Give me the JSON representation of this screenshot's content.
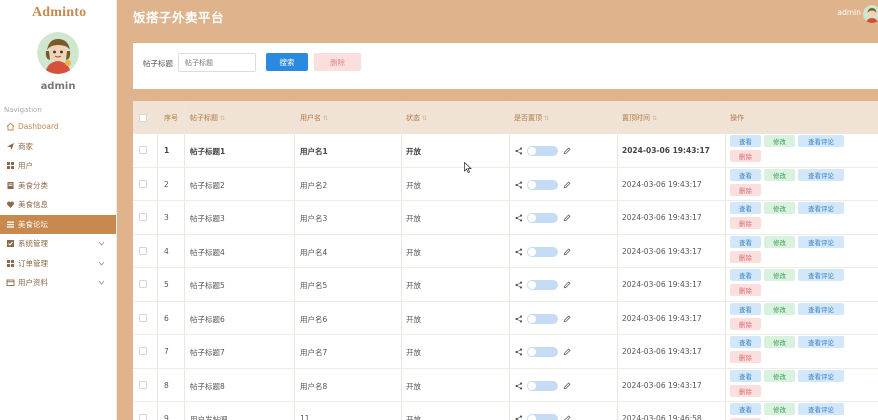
{
  "app": {
    "brand": "Adminto",
    "title": "饭搭子外卖平台",
    "header_user": "admin"
  },
  "colors": {
    "accent": "#c8894f",
    "header_bg": "#dfb48c",
    "primary_button": "#2a8ae0",
    "danger_bg": "#fbdede"
  },
  "sidebar": {
    "username": "admin",
    "nav_title": "Navigation",
    "items": [
      {
        "label": "Dashboard",
        "icon": "home-icon"
      },
      {
        "label": "商家",
        "icon": "send-icon"
      },
      {
        "label": "用户",
        "icon": "grid-icon"
      },
      {
        "label": "美食分类",
        "icon": "doc-icon"
      },
      {
        "label": "美食信息",
        "icon": "heart-icon"
      },
      {
        "label": "美食论坛",
        "icon": "list-icon"
      },
      {
        "label": "系统管理",
        "icon": "check-icon"
      },
      {
        "label": "订单管理",
        "icon": "grid-icon"
      },
      {
        "label": "用户资料",
        "icon": "card-icon"
      }
    ]
  },
  "search": {
    "label": "帖子标题",
    "placeholder": "帖子标题",
    "search_button": "搜索",
    "delete_button": "删除"
  },
  "table": {
    "headers": {
      "index": "序号",
      "title": "帖子标题",
      "user": "用户名",
      "status": "状态",
      "pinned": "是否置顶",
      "pin_time": "置顶时间",
      "actions": "操作"
    },
    "actions": {
      "view": "查看",
      "edit": "修改",
      "comments": "查看评论",
      "delete": "删除"
    },
    "rows": [
      {
        "index": "1",
        "title": "帖子标题1",
        "user": "用户名1",
        "status": "开放",
        "pin_time": "2024-03-06 19:43:17"
      },
      {
        "index": "2",
        "title": "帖子标题2",
        "user": "用户名2",
        "status": "开放",
        "pin_time": "2024-03-06 19:43:17"
      },
      {
        "index": "3",
        "title": "帖子标题3",
        "user": "用户名3",
        "status": "开放",
        "pin_time": "2024-03-06 19:43:17"
      },
      {
        "index": "4",
        "title": "帖子标题4",
        "user": "用户名4",
        "status": "开放",
        "pin_time": "2024-03-06 19:43:17"
      },
      {
        "index": "5",
        "title": "帖子标题5",
        "user": "用户名5",
        "status": "开放",
        "pin_time": "2024-03-06 19:43:17"
      },
      {
        "index": "6",
        "title": "帖子标题6",
        "user": "用户名6",
        "status": "开放",
        "pin_time": "2024-03-06 19:43:17"
      },
      {
        "index": "7",
        "title": "帖子标题7",
        "user": "用户名7",
        "status": "开放",
        "pin_time": "2024-03-06 19:43:17"
      },
      {
        "index": "8",
        "title": "帖子标题8",
        "user": "用户名8",
        "status": "开放",
        "pin_time": "2024-03-06 19:43:17"
      },
      {
        "index": "9",
        "title": "用户发帖吧",
        "user": "11",
        "status": "开放",
        "pin_time": "2024-03-06 19:46:58"
      }
    ]
  }
}
